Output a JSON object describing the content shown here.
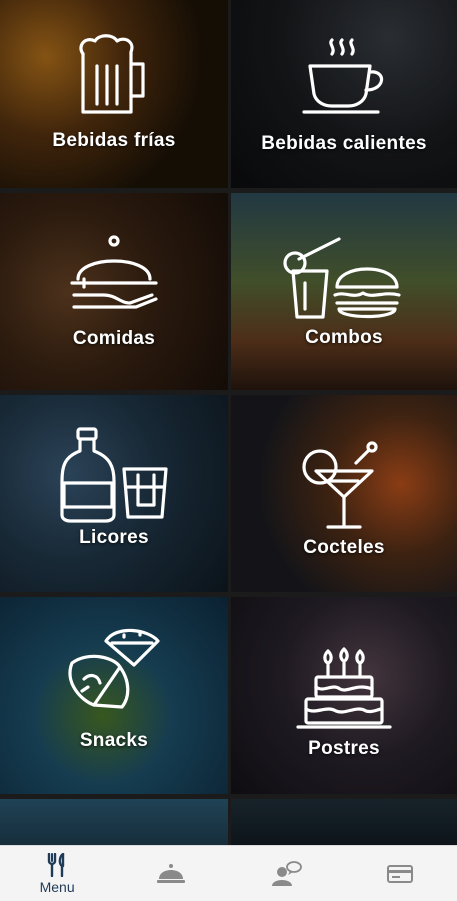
{
  "categories": [
    {
      "label": "Bebidas frías",
      "icon": "beer-mug-icon"
    },
    {
      "label": "Bebidas calientes",
      "icon": "coffee-cup-icon"
    },
    {
      "label": "Comidas",
      "icon": "food-cloche-icon"
    },
    {
      "label": "Combos",
      "icon": "drink-burger-icon"
    },
    {
      "label": "Licores",
      "icon": "liquor-bottle-icon"
    },
    {
      "label": "Cocteles",
      "icon": "cocktail-glass-icon"
    },
    {
      "label": "Snacks",
      "icon": "nachos-icon"
    },
    {
      "label": "Postres",
      "icon": "cake-icon"
    }
  ],
  "bottom_nav": [
    {
      "label": "Menu",
      "icon": "fork-knife-icon",
      "active": true
    },
    {
      "label": "",
      "icon": "cloche-icon",
      "active": false
    },
    {
      "label": "",
      "icon": "waiter-chat-icon",
      "active": false
    },
    {
      "label": "",
      "icon": "credit-card-icon",
      "active": false
    }
  ],
  "colors": {
    "nav_active": "#1f3b57",
    "nav_inactive": "#8a8a8a",
    "nav_background": "#f4f4f4"
  }
}
